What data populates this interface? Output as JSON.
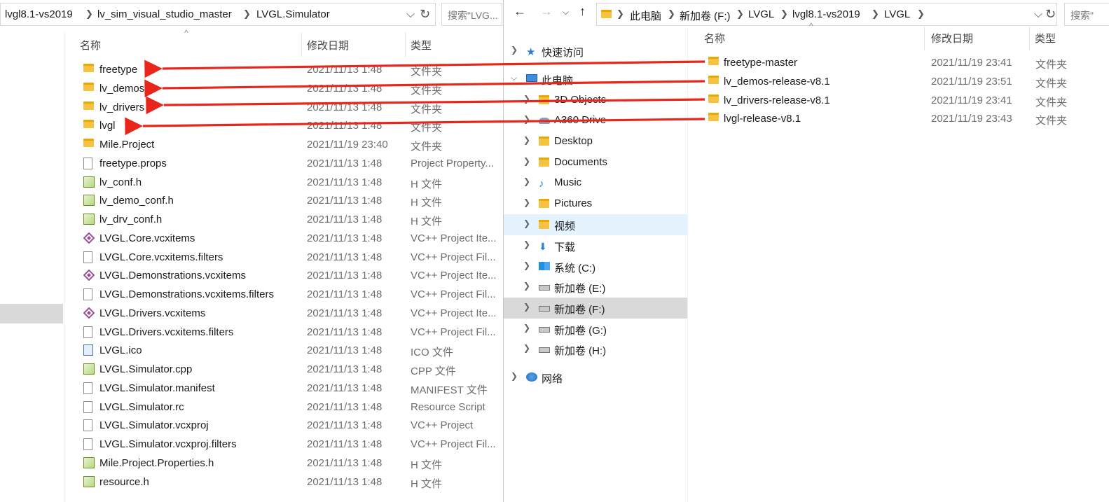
{
  "left": {
    "breadcrumb": [
      "lvgl8.1-vs2019",
      "lv_sim_visual_studio_master",
      "LVGL.Simulator"
    ],
    "search_placeholder": "搜索\"LVG...",
    "columns": {
      "name": "名称",
      "date": "修改日期",
      "type": "类型"
    },
    "files": [
      {
        "name": "freetype",
        "date": "2021/11/13 1:48",
        "type": "文件夹",
        "icon": "folder-icon"
      },
      {
        "name": "lv_demos",
        "date": "2021/11/13 1:48",
        "type": "文件夹",
        "icon": "folder-icon"
      },
      {
        "name": "lv_drivers",
        "date": "2021/11/13 1:48",
        "type": "文件夹",
        "icon": "folder-icon"
      },
      {
        "name": "lvgl",
        "date": "2021/11/13 1:48",
        "type": "文件夹",
        "icon": "folder-icon"
      },
      {
        "name": "Mile.Project",
        "date": "2021/11/19 23:40",
        "type": "文件夹",
        "icon": "folder-icon"
      },
      {
        "name": "freetype.props",
        "date": "2021/11/13 1:48",
        "type": "Project Property...",
        "icon": "file-icon"
      },
      {
        "name": "lv_conf.h",
        "date": "2021/11/13 1:48",
        "type": "H 文件",
        "icon": "header-file-icon"
      },
      {
        "name": "lv_demo_conf.h",
        "date": "2021/11/13 1:48",
        "type": "H 文件",
        "icon": "header-file-icon"
      },
      {
        "name": "lv_drv_conf.h",
        "date": "2021/11/13 1:48",
        "type": "H 文件",
        "icon": "header-file-icon"
      },
      {
        "name": "LVGL.Core.vcxitems",
        "date": "2021/11/13 1:48",
        "type": "VC++ Project Ite...",
        "icon": "vcxitems-icon"
      },
      {
        "name": "LVGL.Core.vcxitems.filters",
        "date": "2021/11/13 1:48",
        "type": "VC++ Project Fil...",
        "icon": "file-icon"
      },
      {
        "name": "LVGL.Demonstrations.vcxitems",
        "date": "2021/11/13 1:48",
        "type": "VC++ Project Ite...",
        "icon": "vcxitems-icon"
      },
      {
        "name": "LVGL.Demonstrations.vcxitems.filters",
        "date": "2021/11/13 1:48",
        "type": "VC++ Project Fil...",
        "icon": "file-icon"
      },
      {
        "name": "LVGL.Drivers.vcxitems",
        "date": "2021/11/13 1:48",
        "type": "VC++ Project Ite...",
        "icon": "vcxitems-icon"
      },
      {
        "name": "LVGL.Drivers.vcxitems.filters",
        "date": "2021/11/13 1:48",
        "type": "VC++ Project Fil...",
        "icon": "file-icon"
      },
      {
        "name": "LVGL.ico",
        "date": "2021/11/13 1:48",
        "type": "ICO 文件",
        "icon": "ico-file-icon"
      },
      {
        "name": "LVGL.Simulator.cpp",
        "date": "2021/11/13 1:48",
        "type": "CPP 文件",
        "icon": "header-file-icon"
      },
      {
        "name": "LVGL.Simulator.manifest",
        "date": "2021/11/13 1:48",
        "type": "MANIFEST 文件",
        "icon": "file-icon"
      },
      {
        "name": "LVGL.Simulator.rc",
        "date": "2021/11/13 1:48",
        "type": "Resource Script",
        "icon": "file-icon"
      },
      {
        "name": "LVGL.Simulator.vcxproj",
        "date": "2021/11/13 1:48",
        "type": "VC++ Project",
        "icon": "file-icon"
      },
      {
        "name": "LVGL.Simulator.vcxproj.filters",
        "date": "2021/11/13 1:48",
        "type": "VC++ Project Fil...",
        "icon": "file-icon"
      },
      {
        "name": "Mile.Project.Properties.h",
        "date": "2021/11/13 1:48",
        "type": "H 文件",
        "icon": "header-file-icon"
      },
      {
        "name": "resource.h",
        "date": "2021/11/13 1:48",
        "type": "H 文件",
        "icon": "header-file-icon"
      }
    ]
  },
  "right": {
    "breadcrumb": [
      "此电脑",
      "新加卷 (F:)",
      "LVGL",
      "lvgl8.1-vs2019",
      "LVGL"
    ],
    "search_placeholder": "搜索\"",
    "columns": {
      "name": "名称",
      "date": "修改日期",
      "type": "类型"
    },
    "nav": [
      {
        "label": "快速访问",
        "icon": "star-icon"
      },
      {
        "label": "此电脑",
        "icon": "computer-icon"
      },
      {
        "label": "3D Objects",
        "icon": "3d-objects-icon"
      },
      {
        "label": "A360 Drive",
        "icon": "a360-drive-icon"
      },
      {
        "label": "Desktop",
        "icon": "desktop-icon"
      },
      {
        "label": "Documents",
        "icon": "documents-icon"
      },
      {
        "label": "Music",
        "icon": "music-icon"
      },
      {
        "label": "Pictures",
        "icon": "pictures-icon"
      },
      {
        "label": "视频",
        "icon": "videos-icon"
      },
      {
        "label": "下载",
        "icon": "downloads-icon"
      },
      {
        "label": "系统 (C:)",
        "icon": "windows-drive-icon"
      },
      {
        "label": "新加卷 (E:)",
        "icon": "drive-icon"
      },
      {
        "label": "新加卷 (F:)",
        "icon": "drive-icon"
      },
      {
        "label": "新加卷 (G:)",
        "icon": "drive-icon"
      },
      {
        "label": "新加卷 (H:)",
        "icon": "drive-icon"
      },
      {
        "label": "网络",
        "icon": "network-icon"
      }
    ],
    "files": [
      {
        "name": "freetype-master",
        "date": "2021/11/19 23:41",
        "type": "文件夹"
      },
      {
        "name": "lv_demos-release-v8.1",
        "date": "2021/11/19 23:51",
        "type": "文件夹"
      },
      {
        "name": "lv_drivers-release-v8.1",
        "date": "2021/11/19 23:41",
        "type": "文件夹"
      },
      {
        "name": "lvgl-release-v8.1",
        "date": "2021/11/19 23:43",
        "type": "文件夹"
      }
    ]
  },
  "colors": {
    "arrow": "#e8261c",
    "nav_hover": "#e5f3ff",
    "nav_selected": "#d9d9d9",
    "vc_icon": "#9b4f96"
  }
}
